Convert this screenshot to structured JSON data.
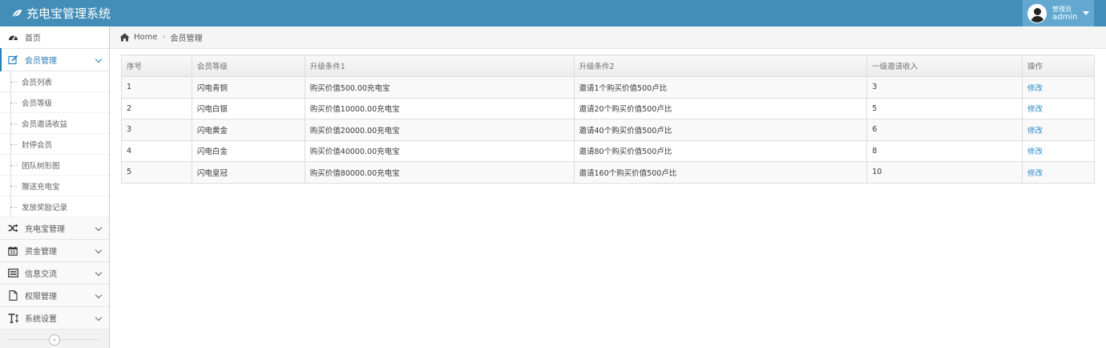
{
  "app": {
    "title": "充电宝管理系统"
  },
  "user": {
    "role": "管理员",
    "name": "admin"
  },
  "sidebar": {
    "items": [
      {
        "label": "首页",
        "icon": "tachometer-icon"
      },
      {
        "label": "会员管理",
        "icon": "edit-icon"
      },
      {
        "label": "充电宝管理",
        "icon": "shuffle-icon"
      },
      {
        "label": "资金管理",
        "icon": "calendar-icon"
      },
      {
        "label": "信息交流",
        "icon": "list-alt-icon"
      },
      {
        "label": "权限管理",
        "icon": "file-icon"
      },
      {
        "label": "系统设置",
        "icon": "text-height-icon"
      }
    ],
    "submenu": [
      "会员列表",
      "会员等级",
      "会员邀请收益",
      "封停会员",
      "团队树形图",
      "赠送充电宝",
      "发放奖励记录"
    ],
    "collapse_symbol": "«"
  },
  "breadcrumb": {
    "home": "Home",
    "current": "会员管理",
    "separator": "›"
  },
  "table": {
    "headers": [
      "序号",
      "会员等级",
      "升级条件1",
      "升级条件2",
      "一级邀请收入",
      "操作"
    ],
    "rows": [
      [
        "1",
        "闪电青铜",
        "购买价值500.00充电宝",
        "邀请1个购买价值500卢比",
        "3",
        "修改"
      ],
      [
        "2",
        "闪电白银",
        "购买价值10000.00充电宝",
        "邀请20个购买价值500卢比",
        "5",
        "修改"
      ],
      [
        "3",
        "闪电黄金",
        "购买价值20000.00充电宝",
        "邀请40个购买价值500卢比",
        "6",
        "修改"
      ],
      [
        "4",
        "闪电白金",
        "购买价值40000.00充电宝",
        "邀请80个购买价值500卢比",
        "8",
        "修改"
      ],
      [
        "5",
        "闪电皇冠",
        "购买价值80000.00充电宝",
        "邀请160个购买价值500卢比",
        "10",
        "修改"
      ]
    ]
  },
  "colors": {
    "navbar": "#438eb9",
    "user_box": "#62a8d1",
    "link": "#2a8bcc",
    "active": "#2b7dbc"
  }
}
